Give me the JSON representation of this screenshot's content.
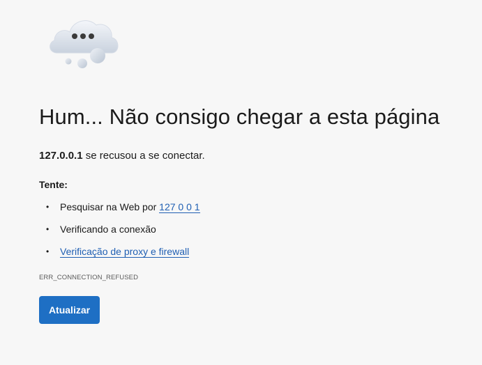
{
  "error": {
    "icon": "cloud-thinking-icon",
    "title": "Hum... Não consigo chegar a esta página",
    "host": "127.0.0.1",
    "description_suffix": " se recusou a se conectar.",
    "try_label": "Tente:",
    "suggestions": [
      {
        "prefix": "Pesquisar na Web por ",
        "link": "127 0 0 1"
      },
      {
        "prefix": "Verificando a conexão",
        "link": ""
      },
      {
        "prefix": "",
        "link": "Verificação de proxy e firewall"
      }
    ],
    "code": "ERR_CONNECTION_REFUSED",
    "button_label": "Atualizar",
    "bullet": "•"
  },
  "colors": {
    "background": "#f7f7f7",
    "link": "#1f5fb3",
    "button": "#1e6fc4"
  }
}
